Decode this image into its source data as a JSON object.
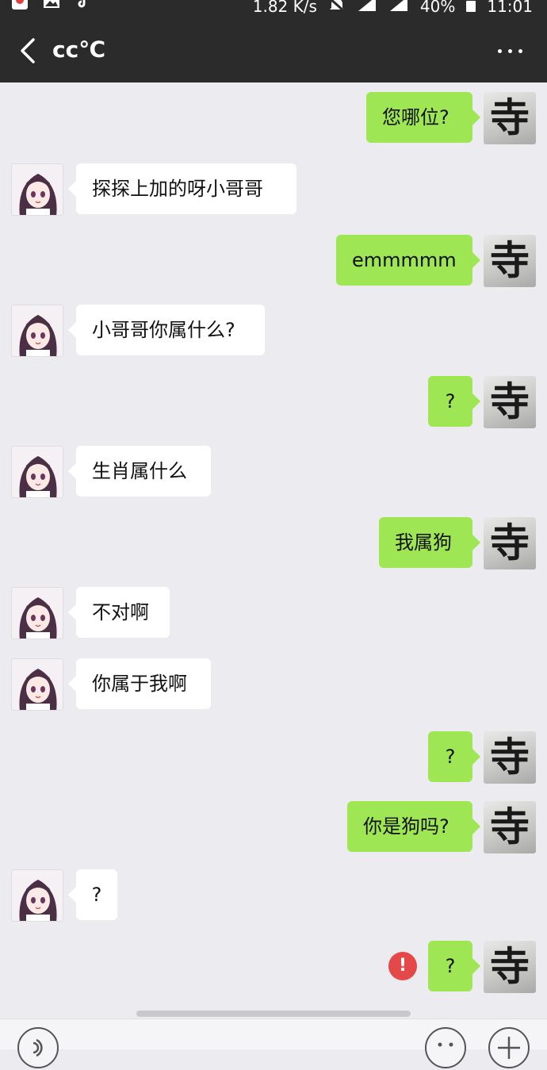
{
  "status_bar": {
    "speed": "1.82 K/s",
    "battery": "40%",
    "time": "11:01"
  },
  "header": {
    "title": "cc℃"
  },
  "messages": [
    {
      "side": "out",
      "text": "您哪位?"
    },
    {
      "side": "in",
      "text": "探探上加的呀小哥哥"
    },
    {
      "side": "out",
      "text": "emmmmm"
    },
    {
      "side": "in",
      "text": "小哥哥你属什么?"
    },
    {
      "side": "out",
      "text": "?"
    },
    {
      "side": "in",
      "text": "生肖属什么"
    },
    {
      "side": "out",
      "text": "我属狗"
    },
    {
      "side": "in",
      "text": "不对啊"
    },
    {
      "side": "in",
      "text": "你属于我啊"
    },
    {
      "side": "out",
      "text": "?"
    },
    {
      "side": "out",
      "text": "你是狗吗?"
    },
    {
      "side": "in",
      "text": "?"
    },
    {
      "side": "out",
      "text": "?",
      "failed": true
    }
  ],
  "error_icon_label": "!",
  "icons": {
    "back": "chevron-left-icon",
    "more": "more-icon",
    "voice": "voice-icon",
    "emoji": "emoji-icon",
    "add": "add-icon",
    "self_avatar_glyph": "寺"
  }
}
